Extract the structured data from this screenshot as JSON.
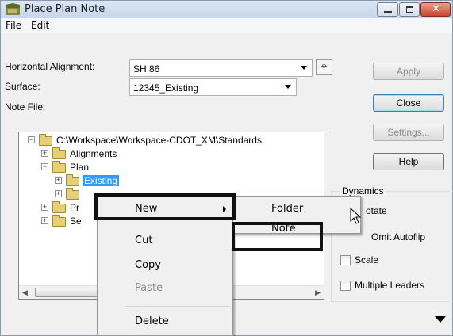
{
  "window": {
    "title": "Place Plan Note"
  },
  "menubar": {
    "items": [
      "File",
      "Edit"
    ]
  },
  "form": {
    "horizontal_alignment_label": "Horizontal Alignment:",
    "horizontal_alignment_value": "SH 86",
    "surface_label": "Surface:",
    "surface_value": "12345_Existing",
    "note_file_label": "Note File:"
  },
  "buttons": {
    "apply": "Apply",
    "close": "Close",
    "settings": "Settings...",
    "help": "Help"
  },
  "tree": {
    "root": "C:\\Workspace\\Workspace-CDOT_XM\\Standards",
    "alignments": "Alignments",
    "plan": "Plan",
    "existing": "Existing",
    "pr_prefix": "Pr",
    "se_prefix": "Se"
  },
  "dynamics": {
    "legend": "Dynamics",
    "rotate": "otate",
    "omit_autoflip": "Omit Autoflip",
    "scale": "Scale",
    "multiple_leaders": "Multiple Leaders"
  },
  "context_menu": {
    "new": "New",
    "cut": "Cut",
    "copy": "Copy",
    "paste": "Paste",
    "delete": "Delete"
  },
  "submenu": {
    "folder": "Folder",
    "note": "Note"
  }
}
